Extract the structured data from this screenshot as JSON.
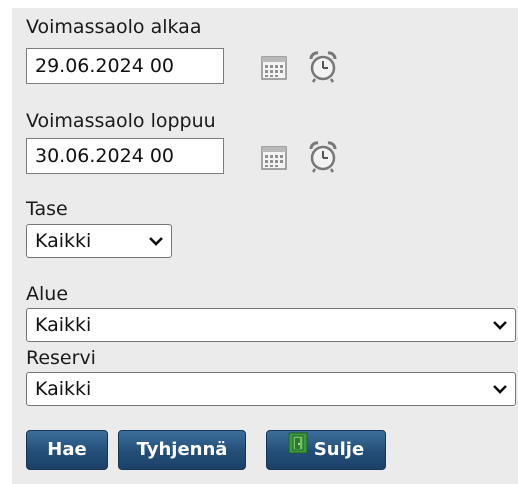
{
  "validity_start": {
    "label": "Voimassaolo alkaa",
    "value": "29.06.2024 00"
  },
  "validity_end": {
    "label": "Voimassaolo loppuu",
    "value": "30.06.2024 00"
  },
  "tase": {
    "label": "Tase",
    "selected": "Kaikki"
  },
  "alue": {
    "label": "Alue",
    "selected": "Kaikki"
  },
  "reservi": {
    "label": "Reservi",
    "selected": "Kaikki"
  },
  "buttons": {
    "search": "Hae",
    "clear": "Tyhjennä",
    "close": "Sulje"
  },
  "icons": {
    "calendar": "calendar-icon",
    "clock": "alarm-clock-icon",
    "dropdown": "chevron-down-icon",
    "close": "exit-door-icon"
  },
  "colors": {
    "panel_background": "#ebebeb",
    "button_blue": "#234e78",
    "close_icon_green": "#3c9b3a"
  }
}
